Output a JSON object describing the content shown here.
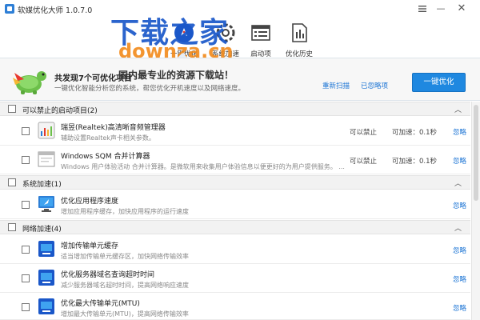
{
  "window": {
    "title": "软媒优化大师 1.0.7.0",
    "menu_icon": "menu-icon",
    "minimize_label": "—",
    "close_label": "✕"
  },
  "watermark": {
    "cn": "下载之家",
    "en": "downza.cn"
  },
  "toolbar": {
    "items": [
      {
        "label": "一键优化",
        "icon": "rocket-icon"
      },
      {
        "label": "系统加速",
        "icon": "gear-icon"
      },
      {
        "label": "启动项",
        "icon": "startup-list-icon"
      },
      {
        "label": "优化历史",
        "icon": "history-doc-icon"
      }
    ]
  },
  "summary": {
    "title": "共发现7个可优化项目",
    "banner": "国内最专业的资源下载站！",
    "description": "一键优化智能分析您的系统，帮您优化开机速度以及网络速度。",
    "rescan_link": "重新扫描",
    "ignored_link": "已忽略项",
    "optimize_button": "一键优化"
  },
  "sections": [
    {
      "title": "可以禁止的启动项目(2)",
      "collapse_glyph": "︿",
      "items": [
        {
          "title": "瑞昱(Realtek)高清晰音频管理器",
          "desc": "辅助设置Realtek声卡相关参数。",
          "status": "可以禁止",
          "speed": "可加速：0.1秒",
          "ignore": "忽略",
          "icon": "audio-manager-icon"
        },
        {
          "title": "Windows SQM 合并计算器",
          "desc": "Windows 用户体验活动 合并计算器。是微软用来收集用户体验信息以便更好的为用户提供服务。 ...",
          "status": "可以禁止",
          "speed": "可加速：0.1秒",
          "ignore": "忽略",
          "icon": "window-app-icon"
        }
      ]
    },
    {
      "title": "系统加速(1)",
      "collapse_glyph": "︿",
      "items": [
        {
          "title": "优化应用程序速度",
          "desc": "增加应用程序缓存，加快应用程序的运行速度",
          "status": "",
          "speed": "",
          "ignore": "忽略",
          "icon": "monitor-rocket-icon"
        }
      ]
    },
    {
      "title": "网络加速(4)",
      "collapse_glyph": "︿",
      "items": [
        {
          "title": "增加传输单元缓存",
          "desc": "适当增加传输单元缓存区，加快网络传输效率",
          "status": "",
          "speed": "",
          "ignore": "忽略",
          "icon": "network-icon"
        },
        {
          "title": "优化服务器域名查询超时时间",
          "desc": "减少服务器域名超时时间，提高网络响应速度",
          "status": "",
          "speed": "",
          "ignore": "忽略",
          "icon": "network-icon"
        },
        {
          "title": "优化最大传输单元(MTU)",
          "desc": "增加最大传输单元(MTU)，提高网络传输效率",
          "status": "",
          "speed": "",
          "ignore": "忽略",
          "icon": "network-icon"
        }
      ]
    }
  ],
  "colors": {
    "accent": "#1f88e0",
    "link": "#1a73d4",
    "watermark_blue": "#1a57c9",
    "watermark_orange": "#f28a1a"
  }
}
